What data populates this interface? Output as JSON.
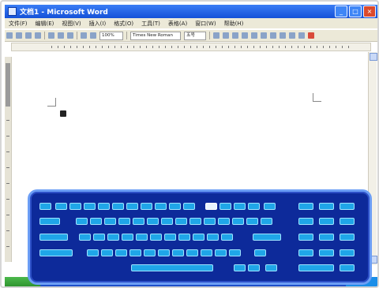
{
  "window": {
    "title": "文档1 - Microsoft Word",
    "min_label": "_",
    "max_label": "□",
    "close_label": "×"
  },
  "menu": {
    "items": [
      {
        "label": "文件(F)"
      },
      {
        "label": "编辑(E)"
      },
      {
        "label": "视图(V)"
      },
      {
        "label": "插入(I)"
      },
      {
        "label": "格式(O)"
      },
      {
        "label": "工具(T)"
      },
      {
        "label": "表格(A)"
      },
      {
        "label": "窗口(W)"
      },
      {
        "label": "帮助(H)"
      }
    ]
  },
  "toolbar": {
    "zoom": "100%",
    "font_name": "Times New Roman",
    "font_size": "五号"
  },
  "colors": {
    "titlebar": "#1551d8",
    "keyboard_bg": "#0d2a9a",
    "key": "#1fa6e8"
  }
}
